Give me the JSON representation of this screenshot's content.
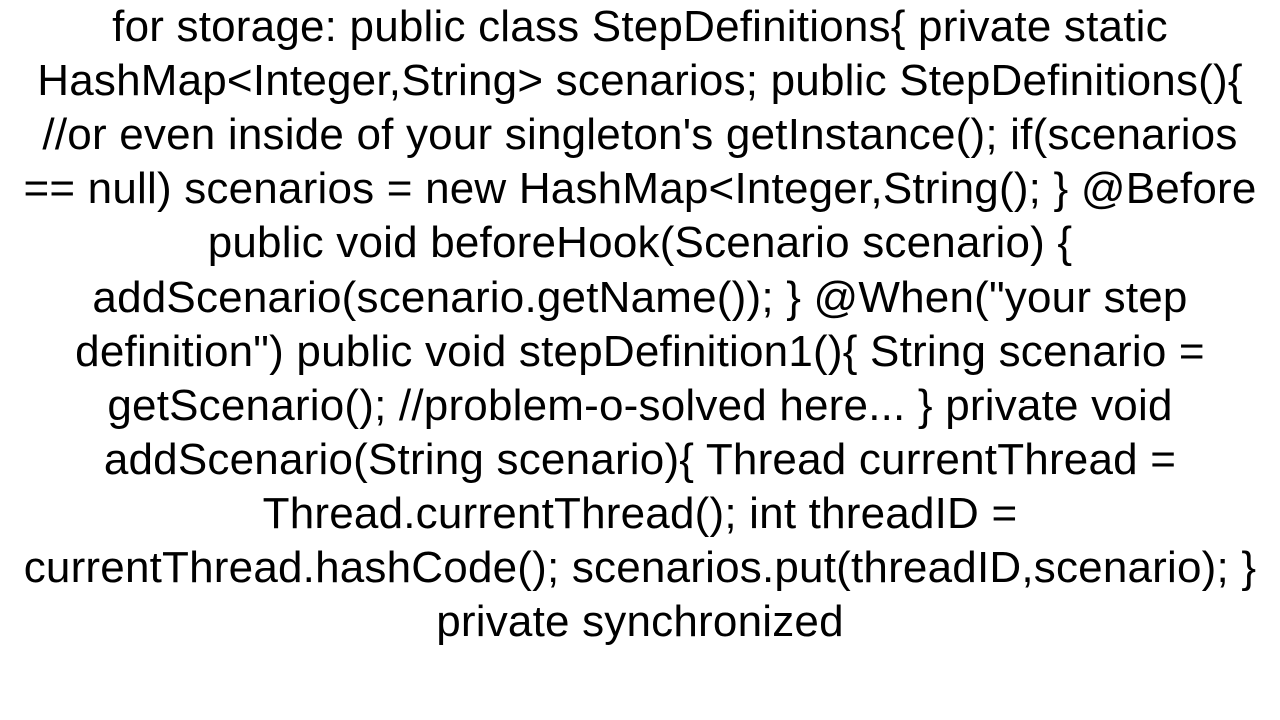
{
  "text": "for storage: public class StepDefinitions{  private static HashMap<Integer,String> scenarios;  public StepDefinitions(){ //or even inside of your singleton's getInstance();  if(scenarios == null)    scenarios = new HashMap<Integer,String(); }  @Before public void beforeHook(Scenario scenario) {   addScenario(scenario.getName()); }  @When(\"your step definition\") public void stepDefinition1(){    String scenario = getScenario(); //problem-o-solved here... }  private void addScenario(String scenario){      Thread currentThread = Thread.currentThread();      int threadID = currentThread.hashCode();     scenarios.put(threadID,scenario); }  private synchronized"
}
